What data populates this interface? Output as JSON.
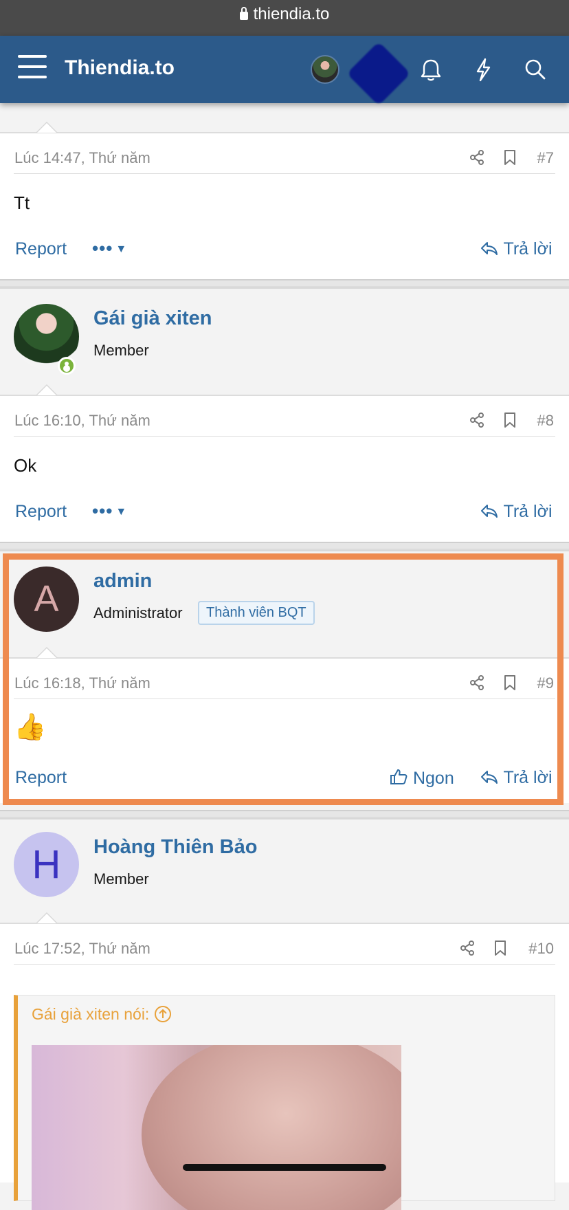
{
  "browser": {
    "url": "thiendia.to"
  },
  "navbar": {
    "brand": "Thiendia.to",
    "icons": [
      "menu-icon",
      "user-avatar",
      "bell-icon",
      "lightning-icon",
      "search-icon"
    ]
  },
  "posts": [
    {
      "time": "Lúc 14:47, Thứ năm",
      "number": "#7",
      "content": "Tt",
      "actions": {
        "report": "Report",
        "more": "•••",
        "reply": "Trả lời"
      }
    },
    {
      "user": {
        "name": "Gái già xiten",
        "role": "Member"
      },
      "time": "Lúc 16:10, Thứ năm",
      "number": "#8",
      "content": "Ok",
      "actions": {
        "report": "Report",
        "more": "•••",
        "reply": "Trả lời"
      }
    },
    {
      "user": {
        "name": "admin",
        "role": "Administrator",
        "badge": "Thành viên BQT",
        "initial": "A"
      },
      "time": "Lúc 16:18, Thứ năm",
      "number": "#9",
      "content": "👍",
      "actions": {
        "report": "Report",
        "like": "Ngon",
        "reply": "Trả lời"
      }
    },
    {
      "user": {
        "name": "Hoàng Thiên Bảo",
        "role": "Member",
        "initial": "H"
      },
      "time": "Lúc 17:52, Thứ năm",
      "number": "#10",
      "quote": {
        "author": "Gái già xiten nói:"
      }
    }
  ],
  "colors": {
    "navbar": "#2c5a8a",
    "link": "#2f6ca3",
    "highlight": "#ee8a4f",
    "quote_accent": "#e8a13a",
    "online": "#7bb33b"
  }
}
